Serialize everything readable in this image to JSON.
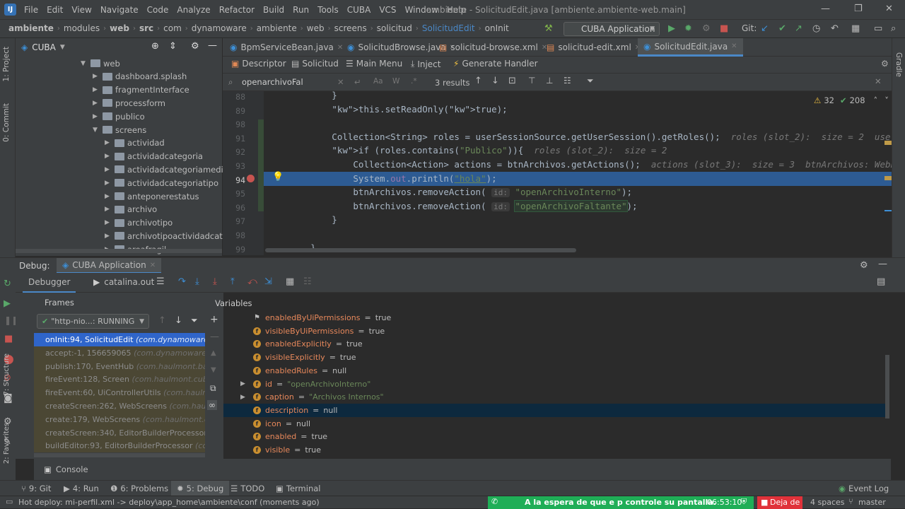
{
  "menu": [
    "File",
    "Edit",
    "View",
    "Navigate",
    "Code",
    "Analyze",
    "Refactor",
    "Build",
    "Run",
    "Tools",
    "CUBA",
    "VCS",
    "Window",
    "Help"
  ],
  "window_title": "ambiente - SolicitudEdit.java [ambiente.ambiente-web.main]",
  "breadcrumbs": [
    "ambiente",
    "modules",
    "web",
    "src",
    "com",
    "dynamoware",
    "ambiente",
    "web",
    "screens",
    "solicitud",
    "SolicitudEdit",
    "onInit"
  ],
  "run_config": "CUBA Application",
  "git_label": "Git:",
  "project": {
    "selector": "CUBA",
    "tree": [
      {
        "label": "web",
        "level": 0,
        "open": true
      },
      {
        "label": "dashboard.splash",
        "level": 1
      },
      {
        "label": "fragmentInterface",
        "level": 1
      },
      {
        "label": "processform",
        "level": 1
      },
      {
        "label": "publico",
        "level": 1
      },
      {
        "label": "screens",
        "level": 1,
        "open": true
      },
      {
        "label": "actividad",
        "level": 2
      },
      {
        "label": "actividadcategoria",
        "level": 2
      },
      {
        "label": "actividadcategoriamedidac",
        "level": 2
      },
      {
        "label": "actividadcategoriatipo",
        "level": 2
      },
      {
        "label": "anteponerestatus",
        "level": 2
      },
      {
        "label": "archivo",
        "level": 2
      },
      {
        "label": "archivotipo",
        "level": 2
      },
      {
        "label": "archivotipoactividadcategc",
        "level": 2
      },
      {
        "label": "areafragil",
        "level": 2
      }
    ]
  },
  "left_tool_tabs": [
    "1: Project",
    "0: Commit"
  ],
  "right_tool_tabs": [
    "Gradle"
  ],
  "editor_tabs": [
    {
      "label": "BpmServiceBean.java",
      "active": false
    },
    {
      "label": "SolicitudBrowse.java",
      "active": false
    },
    {
      "label": "solicitud-browse.xml",
      "active": false
    },
    {
      "label": "solicitud-edit.xml",
      "active": false
    },
    {
      "label": "SolicitudEdit.java",
      "active": true
    }
  ],
  "subtoolbar": [
    "Descriptor",
    "Solicitud",
    "Main Menu",
    "Inject",
    "Generate Handler"
  ],
  "search": {
    "query": "openarchivoFal",
    "results": "3 results"
  },
  "inspection": {
    "warnings": "32",
    "ok": "208"
  },
  "code_lines": [
    {
      "n": "88",
      "text": "            }"
    },
    {
      "n": "89",
      "text": "            this.setReadOnly(true);"
    },
    {
      "n": "98",
      "text": ""
    },
    {
      "n": "91",
      "text": "            Collection<String> roles = userSessionSource.getUserSession().getRoles();  roles (slot_2):  size = 2  userSess"
    },
    {
      "n": "92",
      "text": "            if (roles.contains(\"Publico\")){  roles (slot_2):  size = 2"
    },
    {
      "n": "93",
      "text": "                Collection<Action> actions = btnArchivos.getActions();  actions (slot_3):  size = 3  btnArchivos: WebPop"
    },
    {
      "n": "94",
      "text": "                System.out.println(\"hola\");"
    },
    {
      "n": "95",
      "text": "                btnArchivos.removeAction( id: \"openArchivoInterno\");"
    },
    {
      "n": "96",
      "text": "                btnArchivos.removeAction( id: \"openArchivoFaltante\");"
    },
    {
      "n": "97",
      "text": "            }"
    },
    {
      "n": "98",
      "text": ""
    },
    {
      "n": "99",
      "text": "        }"
    }
  ],
  "debug": {
    "label": "Debug:",
    "config": "CUBA Application",
    "tab_debugger": "Debugger",
    "tab_log": "catalina.out",
    "frames_title": "Frames",
    "variables_title": "Variables",
    "thread": "\"http-nio...: RUNNING",
    "frames": [
      {
        "name": "onInit:94, SolicitudEdit",
        "pkg": "(com.dynamoware.amb",
        "active": true
      },
      {
        "name": "accept:-1, 156659065",
        "pkg": "(com.dynamoware.ambi"
      },
      {
        "name": "publish:170, EventHub",
        "pkg": "(com.haulmont.bali.eve"
      },
      {
        "name": "fireEvent:128, Screen",
        "pkg": "(com.haulmont.cuba.gui"
      },
      {
        "name": "fireEvent:60, UiControllerUtils",
        "pkg": "(com.haulmont.c"
      },
      {
        "name": "createScreen:262, WebScreens",
        "pkg": "(com.haulmont."
      },
      {
        "name": "create:179, WebScreens",
        "pkg": "(com.haulmont.cuba.w"
      },
      {
        "name": "createScreen:340, EditorBuilderProcessor",
        "pkg": "(com"
      },
      {
        "name": "buildEditor:93, EditorBuilderProcessor",
        "pkg": "(com.ha"
      }
    ],
    "variables": [
      {
        "name": "enabledByUiPermissions",
        "value": "true",
        "flag": true
      },
      {
        "name": "visibleByUiPermissions",
        "value": "true"
      },
      {
        "name": "enabledExplicitly",
        "value": "true"
      },
      {
        "name": "visibleExplicitly",
        "value": "true"
      },
      {
        "name": "enabledRules",
        "value": "null"
      },
      {
        "name": "id",
        "value": "\"openArchivoInterno\"",
        "expand": true,
        "str": true
      },
      {
        "name": "caption",
        "value": "\"Archivos Internos\"",
        "expand": true,
        "str": true
      },
      {
        "name": "description",
        "value": "null",
        "selected": true
      },
      {
        "name": "icon",
        "value": "null"
      },
      {
        "name": "enabled",
        "value": "true"
      },
      {
        "name": "visible",
        "value": "true"
      }
    ],
    "console": "Console"
  },
  "bottom_tools": [
    "9: Git",
    "4: Run",
    "6: Problems",
    "5: Debug",
    "TODO",
    "Terminal"
  ],
  "event_log": "Event Log",
  "status": {
    "message": "Hot deploy: mi-perfil.xml -> deploy\\app_home\\ambiente\\conf (moments ago)",
    "notification": "A la espera de que e p controle su pantalla.",
    "time": "06:53:10",
    "stop_button": "Deja de",
    "indent": "4 spaces",
    "branch": "master"
  }
}
